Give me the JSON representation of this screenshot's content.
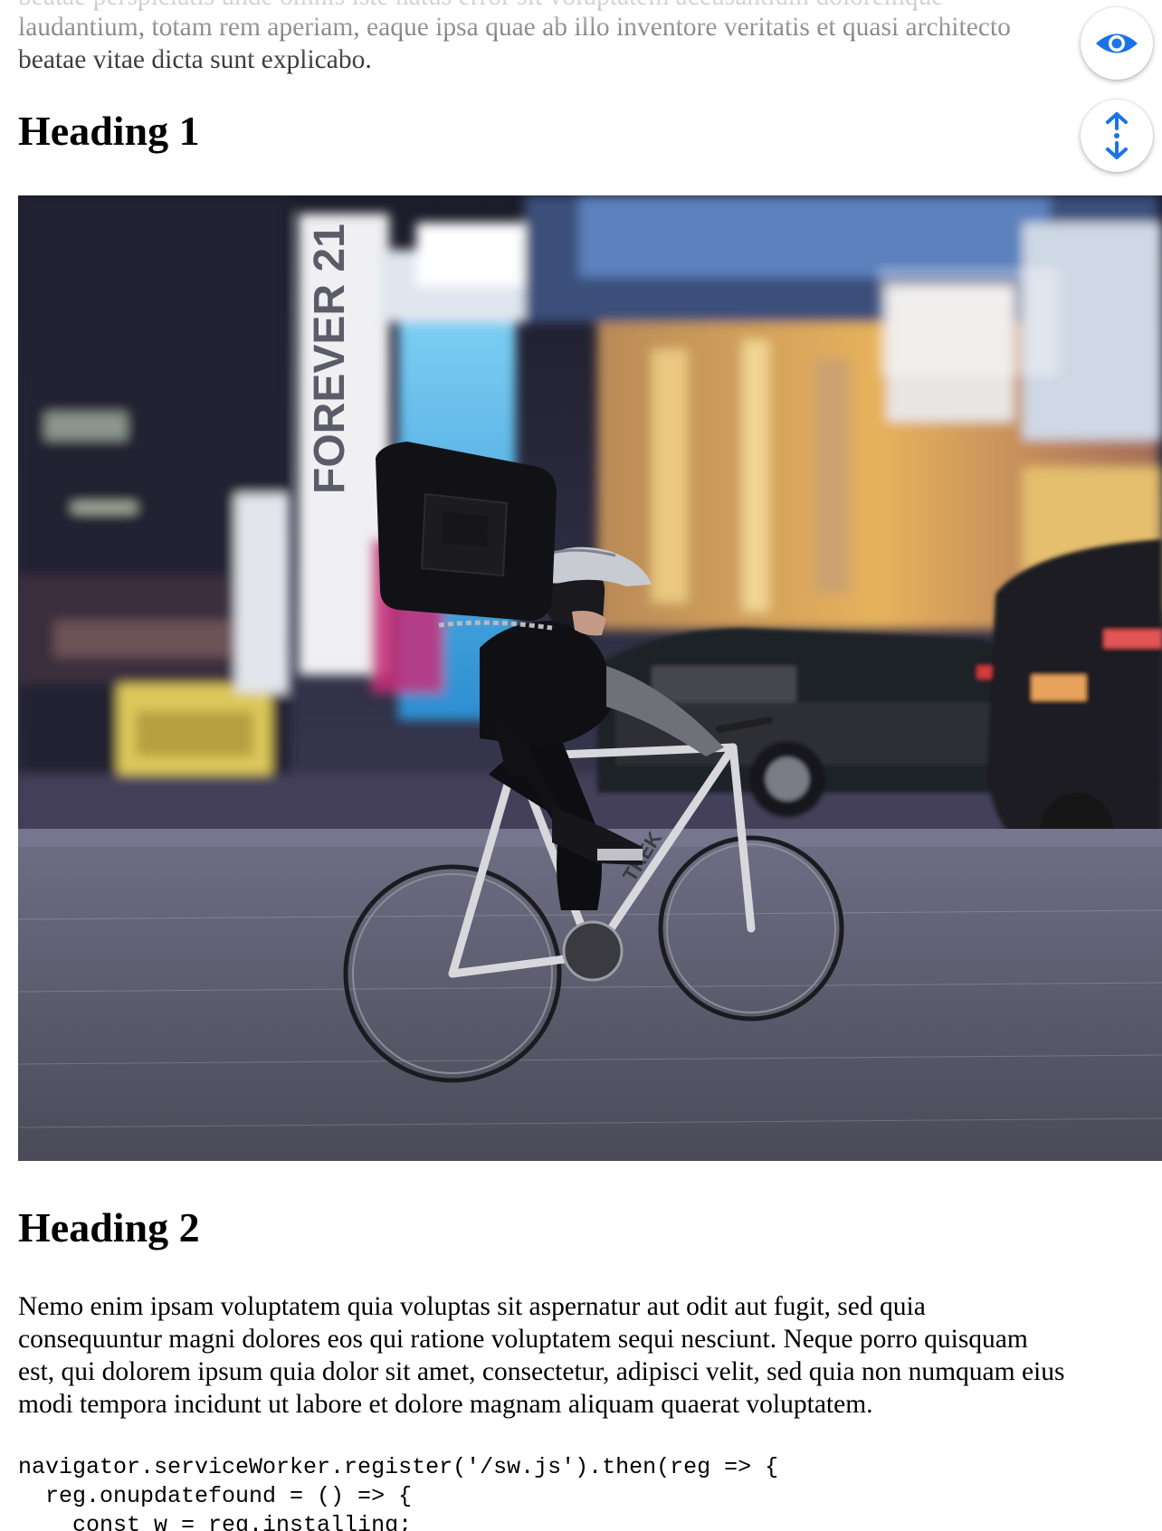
{
  "article": {
    "previous_line_fragment": "beatae perspiciatis unde omnis iste natus error sit voluptatem accusantium doloremque",
    "intro_line_1": "laudantium, totam rem aperiam, eaque ipsa quae ab illo inventore veritatis et quasi architecto",
    "intro_line_2": "beatae vitae dicta sunt explicabo.",
    "heading_1": "Heading 1",
    "photo": {
      "sign_text": "FOREVER 21",
      "bike_brand": "TREK"
    },
    "heading_2": "Heading 2",
    "paragraph_line_1": "Nemo enim ipsam voluptatem quia voluptas sit aspernatur aut odit aut fugit, sed quia",
    "paragraph_line_2": "consequuntur magni dolores eos qui ratione voluptatem sequi nesciunt. Neque porro quisquam",
    "paragraph_line_3": "est, qui dolorem ipsum quia dolor sit amet, consectetur, adipisci velit, sed quia non numquam eius",
    "paragraph_line_4": "modi tempora incidunt ut labore et dolore magnam aliquam quaerat voluptatem.",
    "code_line_1": "navigator.serviceWorker.register('/sw.js').then(reg => {",
    "code_line_2": "  reg.onupdatefound = () => {",
    "code_line_3": "    const w = reg.installing;"
  },
  "floating_buttons": {
    "eye_icon": "eye-icon",
    "nav_icon": "up-down-arrows-icon",
    "accent_color": "#1a73e8"
  }
}
